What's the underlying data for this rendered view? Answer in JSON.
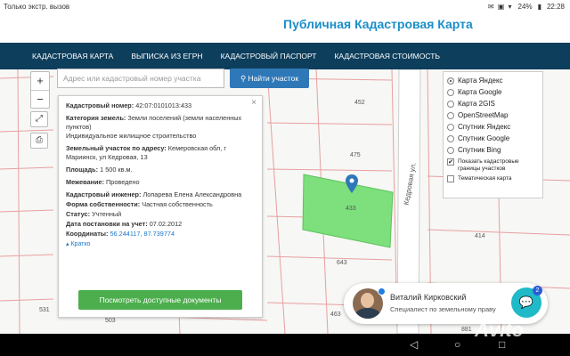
{
  "status_bar": {
    "left_text": "Только экстр. вызов",
    "battery": "24%",
    "time": "22:28"
  },
  "site": {
    "title": "Публичная Кадастровая Карта"
  },
  "nav": {
    "items": [
      "КАДАСТРОВАЯ КАРТА",
      "ВЫПИСКА ИЗ ЕГРН",
      "КАДАСТРОВЫЙ ПАСПОРТ",
      "КАДАСТРОВАЯ СТОИМОСТЬ"
    ]
  },
  "map_controls": {
    "zoom_in": "+",
    "zoom_out": "−",
    "search_placeholder": "Адрес или кадастровый номер участка",
    "search_button": "Найти участок",
    "search_icon": "search-icon",
    "fullscreen_icon": "expand-icon",
    "print_icon": "print-icon"
  },
  "map_labels": {
    "parcels": [
      "452",
      "475",
      "433",
      "414",
      "643",
      "463",
      "503",
      "531",
      "881"
    ],
    "street": "Кедровая ул."
  },
  "info": {
    "cadastral_number_label": "Кадастровый номер:",
    "cadastral_number": "42:07:0101013:433",
    "land_category_label": "Категория земель:",
    "land_category": "Земли поселений (земли населенных пунктов)",
    "permitted_use": "Индивидуальное жилищное строительство",
    "address_label": "Земельный участок по адресу:",
    "address": "Кемеровская обл, г Мариинск, ул Кедровая, 13",
    "area_label": "Площадь:",
    "area": "1 500 кв.м.",
    "boundary_label": "Межевание:",
    "boundary": "Проведено",
    "engineer_label": "Кадастровый инженер:",
    "engineer": "Лопарева Елена Александровна",
    "ownership_label": "Форма собственности:",
    "ownership": "Частная собственность",
    "status_label": "Статус:",
    "status": "Учтенный",
    "registered_label": "Дата постановки на учет:",
    "registered": "07.02.2012",
    "coords_label": "Координаты:",
    "coords": "56.244117, 87.739774",
    "brief": "Кратко",
    "docs_button": "Посмотреть доступные документы"
  },
  "layers": {
    "maps": [
      "Карта Яндекс",
      "Карта Google",
      "Карта 2GIS",
      "OpenStreetMap",
      "Спутник Яндекс",
      "Спутник Google",
      "Спутник Bing"
    ],
    "selected": "Карта Яндекс",
    "show_borders": "Показать кадастровые границы участков",
    "thematic": "Тематическая карта"
  },
  "consultant": {
    "name": "Виталий Кирковский",
    "role": "Специалист по земельному праву",
    "badge": "2"
  },
  "watermark": "Avito",
  "colors": {
    "nav_bg": "#0d3e5c",
    "title": "#1b8ec8",
    "search_btn": "#2f78b8",
    "docs_btn": "#4cae4c",
    "parcel_fill": "#7de07d",
    "chat_btn": "#1fb9c8"
  }
}
